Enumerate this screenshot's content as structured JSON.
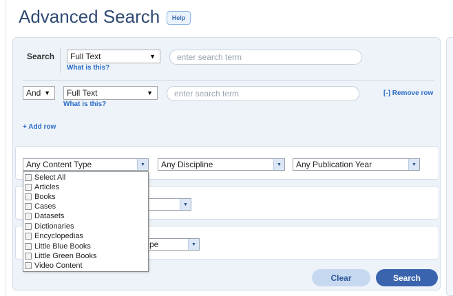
{
  "page": {
    "title": "Advanced Search",
    "help_label": "Help"
  },
  "row1": {
    "label": "Search",
    "field": "Full Text",
    "what_is_this": "What is this?",
    "placeholder": "enter search term"
  },
  "row2": {
    "operator": "And",
    "field": "Full Text",
    "what_is_this": "What is this?",
    "placeholder": "enter search term",
    "remove_label": "[-] Remove row"
  },
  "add_row_label": "+ Add row",
  "filters": {
    "content_type": "Any Content Type",
    "discipline": "Any Discipline",
    "publication_year": "Any Publication Year",
    "hidden_suffix": "pe"
  },
  "content_type_options": [
    "Select All",
    "Articles",
    "Books",
    "Cases",
    "Datasets",
    "Dictionaries",
    "Encyclopedias",
    "Little Blue Books",
    "Little Green Books",
    "Video Content"
  ],
  "buttons": {
    "clear": "Clear",
    "search": "Search"
  },
  "colors": {
    "accent": "#3a64ad",
    "link": "#2b6cc4",
    "panel": "#eef3fa",
    "title": "#2f4a73"
  }
}
